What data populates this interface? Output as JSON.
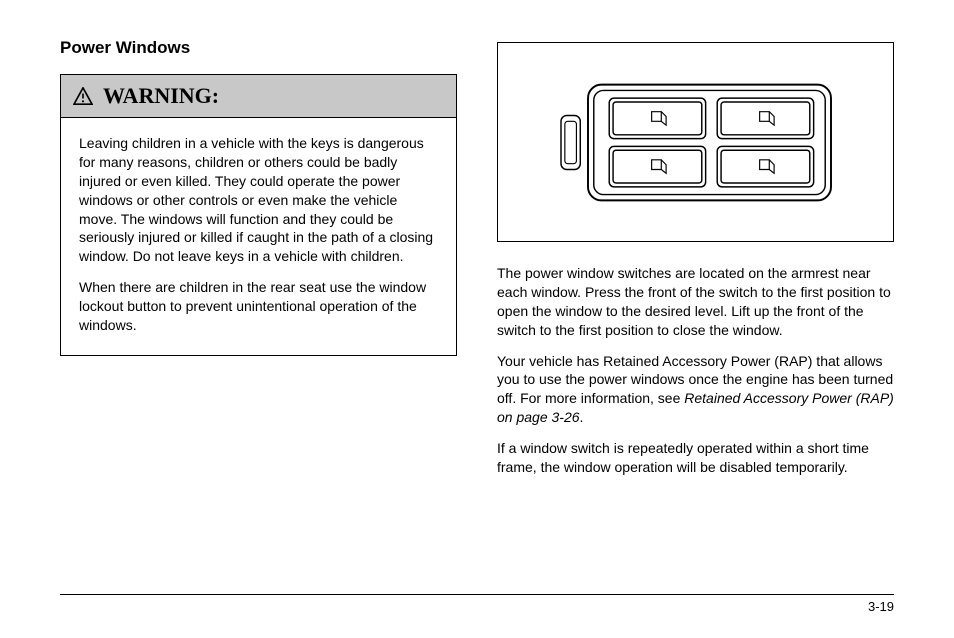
{
  "heading": "Power Windows",
  "warning": {
    "label": "WARNING:",
    "para1": "Leaving children in a vehicle with the keys is dangerous for many reasons, children or others could be badly injured or even killed. They could operate the power windows or other controls or even make the vehicle move. The windows will function and they could be seriously injured or killed if caught in the path of a closing window. Do not leave keys in a vehicle with children.",
    "para2": "When there are children in the rear seat use the window lockout button to prevent unintentional operation of the windows."
  },
  "body": {
    "para1": "The power window switches are located on the armrest near each window. Press the front of the switch to the first position to open the window to the desired level. Lift up the front of the switch to the first position to close the window.",
    "para2a": "Your vehicle has Retained Accessory Power (RAP) that allows you to use the power windows once the engine has been turned off. For more information, see ",
    "para2b": "Retained Accessory Power (RAP) on page 3-26",
    "para2c": ".",
    "para3": "If a window switch is repeatedly operated within a short time frame, the window operation will be disabled temporarily."
  },
  "page_number": "3-19"
}
